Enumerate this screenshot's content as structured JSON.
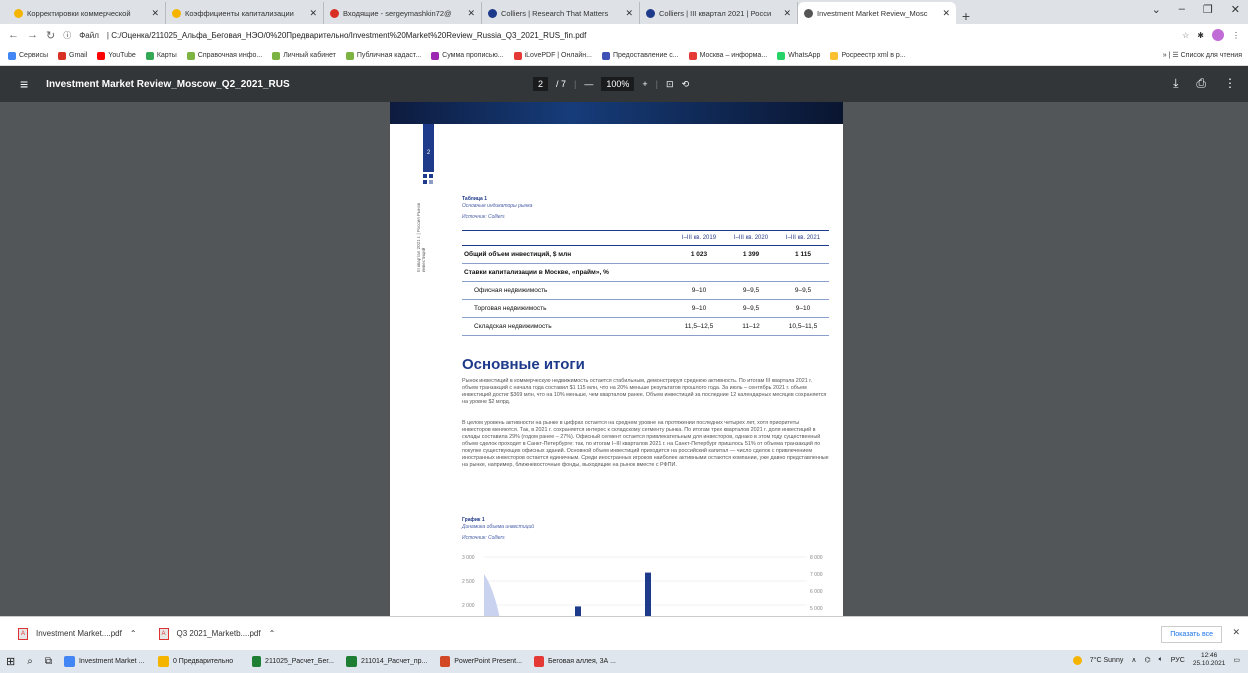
{
  "tabs": [
    {
      "title": "Корректировки коммерческой",
      "color": "#f4b400"
    },
    {
      "title": "Коэффициенты капитализации",
      "color": "#f4b400"
    },
    {
      "title": "Входящие - sergeymashkin72@",
      "color": "#d93025"
    },
    {
      "title": "Colliers | Research That Matters",
      "color": "#1e3a8a"
    },
    {
      "title": "Colliers | III квартал 2021 | Росси",
      "color": "#1e3a8a"
    },
    {
      "title": "Investment Market Review_Mosc",
      "color": "#555"
    }
  ],
  "url_prefix": "Файл",
  "url": "C:/Оценка/211025_Альфа_Беговая_НЭО/0%20Предварительно/Investment%20Market%20Review_Russia_Q3_2021_RUS_fin.pdf",
  "bookmarks": [
    {
      "label": "Сервисы",
      "color": "#4285f4"
    },
    {
      "label": "Gmail",
      "color": "#d93025"
    },
    {
      "label": "YouTube",
      "color": "#ff0000"
    },
    {
      "label": "Карты",
      "color": "#34a853"
    },
    {
      "label": "Справочная инфо...",
      "color": "#7cb342"
    },
    {
      "label": "Личный кабинет",
      "color": "#7cb342"
    },
    {
      "label": "Публичная кадаст...",
      "color": "#7cb342"
    },
    {
      "label": "Сумма прописью...",
      "color": "#9c27b0"
    },
    {
      "label": "iLovePDF | Онлайн...",
      "color": "#e53935"
    },
    {
      "label": "Предоставление с...",
      "color": "#3f51b5"
    },
    {
      "label": "Москва – информа...",
      "color": "#e53935"
    },
    {
      "label": "WhatsApp",
      "color": "#25d366"
    },
    {
      "label": "Росреестр xml в p...",
      "color": "#fbc02d"
    }
  ],
  "bookmarks_more": "Список для чтения",
  "pdf": {
    "title": "Investment Market Review_Moscow_Q2_2021_RUS",
    "page": "2",
    "total": "/ 7",
    "zoom": "100%"
  },
  "doc": {
    "page_number": "2",
    "side_text": "III квартал 2021 г. | Россия Рынок инвестиций",
    "table_title": "Таблица 1",
    "table_subtitle": "Основные индикаторы рынка",
    "table_source": "Источник: Colliers",
    "columns": [
      "I–III кв. 2019",
      "I–III кв. 2020",
      "I–III кв. 2021"
    ],
    "rows": [
      {
        "label": "Общий объем инвестиций, $ млн",
        "values": [
          "1 023",
          "1 399",
          "1 115"
        ],
        "kind": "bold"
      },
      {
        "label": "Ставки капитализации в Москве, «прайм», %",
        "values": [
          "",
          "",
          ""
        ],
        "kind": "bold"
      },
      {
        "label": "Офисная недвижимость",
        "values": [
          "9–10",
          "9–9,5",
          "9–9,5"
        ],
        "kind": "sub"
      },
      {
        "label": "Торговая недвижимость",
        "values": [
          "9–10",
          "9–9,5",
          "9–10"
        ],
        "kind": "sub"
      },
      {
        "label": "Складская недвижимость",
        "values": [
          "11,5–12,5",
          "11–12",
          "10,5–11,5"
        ],
        "kind": "sub"
      }
    ],
    "heading": "Основные итоги",
    "para1": "Рынок инвестиций в коммерческую недвижимость остается стабильным, демонстрируя среднюю активность. По итогам III квартала 2021 г. объем транзакций с начала года составил $1 115 млн, что на 20% меньше результатов прошлого года. За июль – сентябрь 2021 г. объем инвестиций достиг $369 млн, что на 10% меньше, чем кварталом ранее. Объем инвестиций за последние 12 календарных месяцев сохраняется на уровне $2 млрд.",
    "para2": "В целом уровень активности на рынке в цифрах остается на среднем уровне на протяжении последних четырех лет, хотя приоритеты инвесторов меняются. Так, в 2021 г. сохраняется интерес к складскому сегменту рынка. По итогам трех кварталов 2021 г. доля инвестиций в склады составила 29% (годом ранее – 27%). Офисный сегмент остается привлекательным для инвесторов, однако в этом году существенный объем сделок проходит в Санкт-Петербурге: так, по итогам I–III кварталов 2021 г. на Санкт-Петербург пришлось 51% от объема транзакций по покупке существующих офисных зданий. Основной объем инвестиций приходится на российский капитал — число сделок с привлечением иностранных инвесторов остается единичным. Среди иностранных игроков наиболее активными остаются компании, уже давно представленные на рынке, например, ближневосточные фонды, выходящие на рынок вместе с РФПИ.",
    "chart_title": "График 1",
    "chart_subtitle": "Динамика объема инвестиций",
    "chart_source": "Источник: Colliers"
  },
  "chart_data": {
    "type": "bar",
    "left_ticks": [
      "3 000",
      "2 500",
      "2 000"
    ],
    "right_ticks": [
      "8 000",
      "7 000",
      "6 000",
      "5 000"
    ],
    "ylim_left": [
      2000,
      3000
    ],
    "bars": [
      {
        "value": 2050,
        "color": "#1e3a8a"
      },
      {
        "value": 2700,
        "color": "#1e3a8a"
      }
    ],
    "area_color": "#c9d3ef"
  },
  "downloads": [
    {
      "name": "Investment Market....pdf"
    },
    {
      "name": "Q3 2021_Marketb....pdf"
    }
  ],
  "show_all": "Показать все",
  "taskbar": [
    {
      "label": "Investment Market ...",
      "color": "#4285f4"
    },
    {
      "label": "0 Предварительно",
      "color": "#f4b400"
    },
    {
      "label": "211025_Расчет_Бег...",
      "color": "#1e7e34"
    },
    {
      "label": "211014_Расчет_пр...",
      "color": "#1e7e34"
    },
    {
      "label": "PowerPoint Present...",
      "color": "#d24726"
    },
    {
      "label": "Беговая аллея, 3А ...",
      "color": "#e53935"
    }
  ],
  "tray": {
    "weather": "7°C  Sunny",
    "lang": "РУС",
    "time": "12:46",
    "date": "25.10.2021"
  }
}
